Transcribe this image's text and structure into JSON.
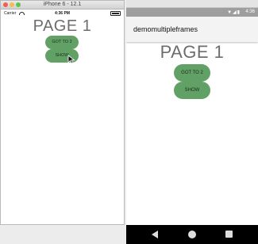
{
  "ios": {
    "window_title": "iPhone 6 - 12.1",
    "status": {
      "carrier": "Carrier",
      "time": "4:36 PM"
    },
    "page_title": "PAGE 1",
    "buttons": [
      {
        "label": "GOT TO 2"
      },
      {
        "label": "SHOW"
      }
    ],
    "icons": [
      "wifi-icon",
      "battery-icon",
      "pointer-cursor-icon"
    ],
    "colors": {
      "button": "#62a165",
      "title_text": "#6d6d6d"
    }
  },
  "android": {
    "status": {
      "time": "4:36"
    },
    "appbar_title": "demomultipleframes",
    "page_title": "PAGE 1",
    "buttons": [
      {
        "label": "GOT TO 2"
      },
      {
        "label": "SHOW"
      }
    ],
    "icons": [
      "signal-icon",
      "wifi-icon",
      "battery-icon",
      "back-icon",
      "home-icon",
      "recents-icon"
    ],
    "colors": {
      "button": "#62a165",
      "statusbar": "#9e9e9e",
      "navbar": "#000000"
    }
  }
}
